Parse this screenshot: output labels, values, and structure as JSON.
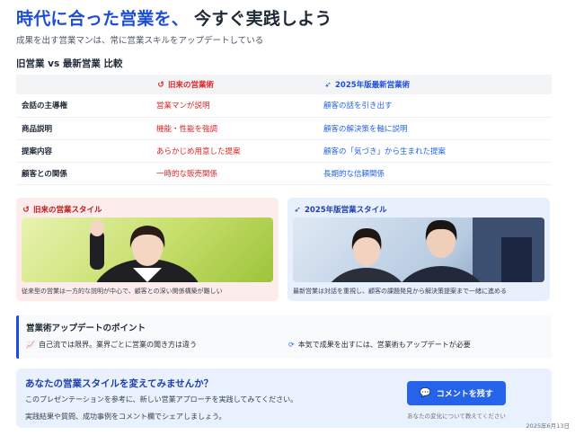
{
  "header": {
    "title_highlight": "時代に合った営業を、",
    "title_rest": "今すぐ実践しよう",
    "subtitle": "成果を出す営業マンは、常に営業スキルをアップデートしている"
  },
  "comparison": {
    "heading": "旧営業 vs 最新営業 比較",
    "col_old": "旧来の営業術",
    "col_new": "2025年版最新営業術",
    "rows": [
      {
        "key": "会話の主導権",
        "old": "営業マンが説明",
        "new": "顧客の話を引き出す"
      },
      {
        "key": "商品説明",
        "old": "機能・性能を強調",
        "new": "顧客の解決策を軸に説明"
      },
      {
        "key": "提案内容",
        "old": "あらかじめ用意した提案",
        "new": "顧客の「気づき」から生まれた提案"
      },
      {
        "key": "顧客との関係",
        "old": "一時的な販売関係",
        "new": "長期的な信頼関係"
      }
    ]
  },
  "cards": {
    "old": {
      "title": "旧来の営業スタイル",
      "caption": "従来型の営業は一方的な説明が中心で、顧客との深い関係構築が難しい"
    },
    "new": {
      "title": "2025年版営業スタイル",
      "caption": "最新営業は対話を重視し、顧客の課題発見から解決策提案まで一緒に進める"
    }
  },
  "points": {
    "heading": "営業術アップデートのポイント",
    "left": "自己流では限界。業界ごとに営業の聞き方は違う",
    "right": "本気で成果を出すには、営業術もアップデートが必要"
  },
  "cta": {
    "heading": "あなたの営業スタイルを変えてみませんか？",
    "line1": "このプレゼンテーションを参考に、新しい営業アプローチを実践してみてください。",
    "line2": "実践結果や質問、成功事例をコメント欄でシェアしましょう。",
    "button": "コメントを残す",
    "note": "あなたの変化について教えてください"
  },
  "footer": {
    "date": "2025年6月13日"
  },
  "colors": {
    "accent": "#1d4ed8",
    "old_red": "#dc2626",
    "new_blue": "#2563eb"
  },
  "icons": {
    "old": "history-icon",
    "new": "rocket-icon",
    "chart": "chart-line-icon",
    "refresh": "refresh-icon",
    "comment": "comments-icon"
  }
}
